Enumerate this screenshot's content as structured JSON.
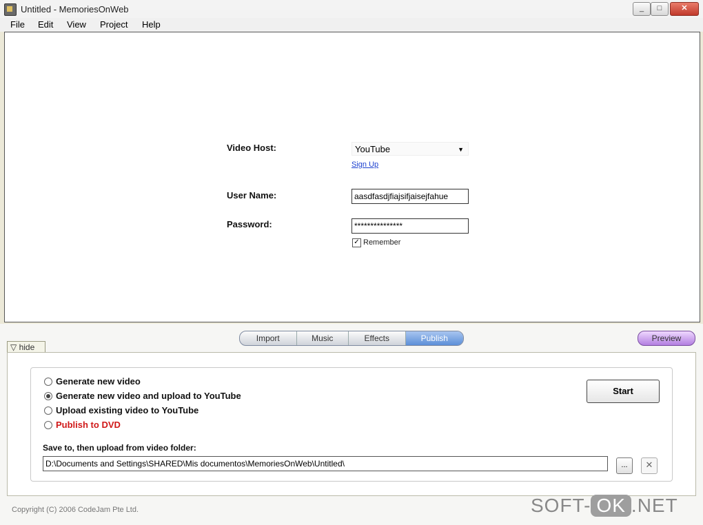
{
  "window": {
    "title": "Untitled - MemoriesOnWeb"
  },
  "menu": [
    "File",
    "Edit",
    "View",
    "Project",
    "Help"
  ],
  "form": {
    "video_host_label": "Video Host:",
    "video_host_value": "YouTube",
    "signup_link": "Sign Up",
    "username_label": "User Name:",
    "username_value": "aasdfasdjfiajsifjaisejfahue",
    "password_label": "Password:",
    "password_value": "***************",
    "remember_label": "Remember",
    "remember_checked": true
  },
  "tabs": {
    "items": [
      "Import",
      "Music",
      "Effects",
      "Publish"
    ],
    "active": "Publish"
  },
  "preview_label": "Preview",
  "hide_label": "▽ hide",
  "publish": {
    "options": [
      {
        "label": "Generate new video",
        "selected": false,
        "color": "#111111"
      },
      {
        "label": "Generate new video and upload to YouTube",
        "selected": true,
        "color": "#111111"
      },
      {
        "label": "Upload existing video to YouTube",
        "selected": false,
        "color": "#111111"
      },
      {
        "label": "Publish to DVD",
        "selected": false,
        "color": "#d01818"
      }
    ],
    "start_label": "Start",
    "save_label": "Save to, then upload from video folder:",
    "path_value": "D:\\Documents and Settings\\SHARED\\Mis documentos\\MemoriesOnWeb\\Untitled\\",
    "browse_label": "...",
    "clear_label": "✕"
  },
  "copyright": "Copyright (C) 2006 CodeJam Pte Ltd.",
  "watermark": {
    "left": "SOFT-",
    "ok": "OK",
    "right": ".NET"
  },
  "icons": {
    "app": "app-icon",
    "dropdown": "chevron-down-icon",
    "check": "check-icon"
  },
  "colors": {
    "link": "#1b3fcf",
    "dvd_option": "#d01818",
    "active_tab": "#5c8fd8",
    "preview": "#b27ee0"
  }
}
